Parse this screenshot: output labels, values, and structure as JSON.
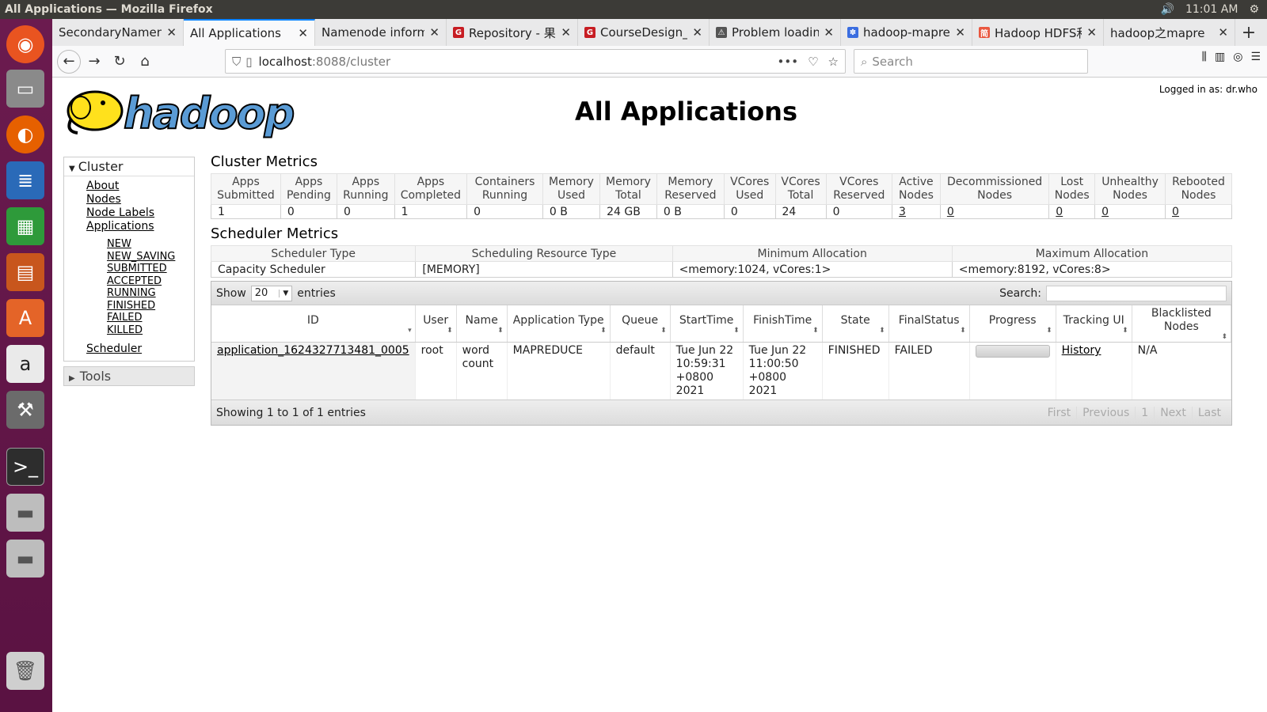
{
  "os": {
    "window_title": "All Applications — Mozilla Firefox",
    "clock": "11:01 AM",
    "colors": {
      "launcher": "#5e1446",
      "topbar": "#3c3b37"
    },
    "launcher_icons": [
      "ubuntu-icon",
      "files-icon",
      "firefox-icon",
      "writer-icon",
      "calc-icon",
      "impress-icon",
      "software-icon",
      "amazon-icon",
      "settings-icon",
      "terminal-icon",
      "disk-icon",
      "disk2-icon",
      "trash-icon"
    ]
  },
  "browser": {
    "tabs": [
      {
        "label": "SecondaryNameno",
        "fav": "",
        "favcolor": "#ffffff"
      },
      {
        "label": "All Applications",
        "fav": "",
        "favcolor": "#ffffff"
      },
      {
        "label": "Namenode informa",
        "fav": "",
        "favcolor": "#ffffff"
      },
      {
        "label": "Repository - 果",
        "fav": "G",
        "favcolor": "#c71d23"
      },
      {
        "label": "CourseDesign_",
        "fav": "G",
        "favcolor": "#c71d23"
      },
      {
        "label": "Problem loadin",
        "fav": "⚠",
        "favcolor": "#555555"
      },
      {
        "label": "hadoop-mapred",
        "fav": "✽",
        "favcolor": "#3a6de0"
      },
      {
        "label": "Hadoop HDFS和",
        "fav": "简",
        "favcolor": "#e9573f"
      },
      {
        "label": "hadoop之mapre",
        "fav": "",
        "favcolor": "#ffffff"
      }
    ],
    "url_host": "localhost",
    "url_path": ":8088/cluster",
    "search_placeholder": "Search"
  },
  "page": {
    "logged_in": "Logged in as: dr.who",
    "title": "All Applications",
    "logo_text": "hadoop",
    "sidebar": {
      "cluster_label": "Cluster",
      "links": [
        "About",
        "Nodes",
        "Node Labels",
        "Applications"
      ],
      "app_states": [
        "NEW",
        "NEW_SAVING",
        "SUBMITTED",
        "ACCEPTED",
        "RUNNING",
        "FINISHED",
        "FAILED",
        "KILLED"
      ],
      "scheduler": "Scheduler",
      "tools_label": "Tools"
    },
    "cluster_metrics": {
      "title": "Cluster Metrics",
      "headers": [
        "Apps Submitted",
        "Apps Pending",
        "Apps Running",
        "Apps Completed",
        "Containers Running",
        "Memory Used",
        "Memory Total",
        "Memory Reserved",
        "VCores Used",
        "VCores Total",
        "VCores Reserved",
        "Active Nodes",
        "Decommissioned Nodes",
        "Lost Nodes",
        "Unhealthy Nodes",
        "Rebooted Nodes"
      ],
      "values": [
        "1",
        "0",
        "0",
        "1",
        "0",
        "0 B",
        "24 GB",
        "0 B",
        "0",
        "24",
        "0",
        "3",
        "0",
        "0",
        "0",
        "0"
      ]
    },
    "scheduler_metrics": {
      "title": "Scheduler Metrics",
      "headers": [
        "Scheduler Type",
        "Scheduling Resource Type",
        "Minimum Allocation",
        "Maximum Allocation"
      ],
      "values": [
        "Capacity Scheduler",
        "[MEMORY]",
        "<memory:1024, vCores:1>",
        "<memory:8192, vCores:8>"
      ]
    },
    "apps_table": {
      "show_label": "Show",
      "entries_value": "20",
      "entries_label": "entries",
      "search_label": "Search:",
      "headers": [
        "ID",
        "User",
        "Name",
        "Application Type",
        "Queue",
        "StartTime",
        "FinishTime",
        "State",
        "FinalStatus",
        "Progress",
        "Tracking UI",
        "Blacklisted Nodes"
      ],
      "rows": [
        {
          "id": "application_1624327713481_0005",
          "user": "root",
          "name": "word count",
          "type": "MAPREDUCE",
          "queue": "default",
          "start": "Tue Jun 22 10:59:31 +0800 2021",
          "finish": "Tue Jun 22 11:00:50 +0800 2021",
          "state": "FINISHED",
          "final": "FAILED",
          "progress": 0,
          "tracking": "History",
          "blacklisted": "N/A"
        }
      ],
      "info": "Showing 1 to 1 of 1 entries",
      "pager": [
        "First",
        "Previous",
        "1",
        "Next",
        "Last"
      ]
    }
  }
}
